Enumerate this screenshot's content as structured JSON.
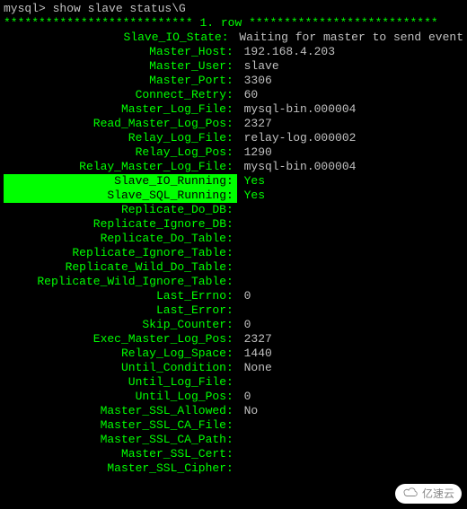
{
  "prompt": "mysql> ",
  "command": "show slave status\\G",
  "stars": "***************************",
  "row_label": " 1. row ",
  "rows": [
    {
      "k": "Slave_IO_State",
      "v": "Waiting for master to send event",
      "hl": false
    },
    {
      "k": "Master_Host",
      "v": "192.168.4.203",
      "hl": false
    },
    {
      "k": "Master_User",
      "v": "slave",
      "hl": false
    },
    {
      "k": "Master_Port",
      "v": "3306",
      "hl": false
    },
    {
      "k": "Connect_Retry",
      "v": "60",
      "hl": false
    },
    {
      "k": "Master_Log_File",
      "v": "mysql-bin.000004",
      "hl": false
    },
    {
      "k": "Read_Master_Log_Pos",
      "v": "2327",
      "hl": false
    },
    {
      "k": "Relay_Log_File",
      "v": "relay-log.000002",
      "hl": false
    },
    {
      "k": "Relay_Log_Pos",
      "v": "1290",
      "hl": false
    },
    {
      "k": "Relay_Master_Log_File",
      "v": "mysql-bin.000004",
      "hl": false
    },
    {
      "k": "Slave_IO_Running",
      "v": "Yes",
      "hl": true
    },
    {
      "k": "Slave_SQL_Running",
      "v": "Yes",
      "hl": true
    },
    {
      "k": "Replicate_Do_DB",
      "v": "",
      "hl": false
    },
    {
      "k": "Replicate_Ignore_DB",
      "v": "",
      "hl": false
    },
    {
      "k": "Replicate_Do_Table",
      "v": "",
      "hl": false
    },
    {
      "k": "Replicate_Ignore_Table",
      "v": "",
      "hl": false
    },
    {
      "k": "Replicate_Wild_Do_Table",
      "v": "",
      "hl": false
    },
    {
      "k": "Replicate_Wild_Ignore_Table",
      "v": "",
      "hl": false
    },
    {
      "k": "Last_Errno",
      "v": "0",
      "hl": false
    },
    {
      "k": "Last_Error",
      "v": "",
      "hl": false
    },
    {
      "k": "Skip_Counter",
      "v": "0",
      "hl": false
    },
    {
      "k": "Exec_Master_Log_Pos",
      "v": "2327",
      "hl": false
    },
    {
      "k": "Relay_Log_Space",
      "v": "1440",
      "hl": false
    },
    {
      "k": "Until_Condition",
      "v": "None",
      "hl": false
    },
    {
      "k": "Until_Log_File",
      "v": "",
      "hl": false
    },
    {
      "k": "Until_Log_Pos",
      "v": "0",
      "hl": false
    },
    {
      "k": "Master_SSL_Allowed",
      "v": "No",
      "hl": false
    },
    {
      "k": "Master_SSL_CA_File",
      "v": "",
      "hl": false
    },
    {
      "k": "Master_SSL_CA_Path",
      "v": "",
      "hl": false
    },
    {
      "k": "Master_SSL_Cert",
      "v": "",
      "hl": false
    },
    {
      "k": "Master_SSL_Cipher",
      "v": "",
      "hl": false
    }
  ],
  "watermark": "亿速云"
}
